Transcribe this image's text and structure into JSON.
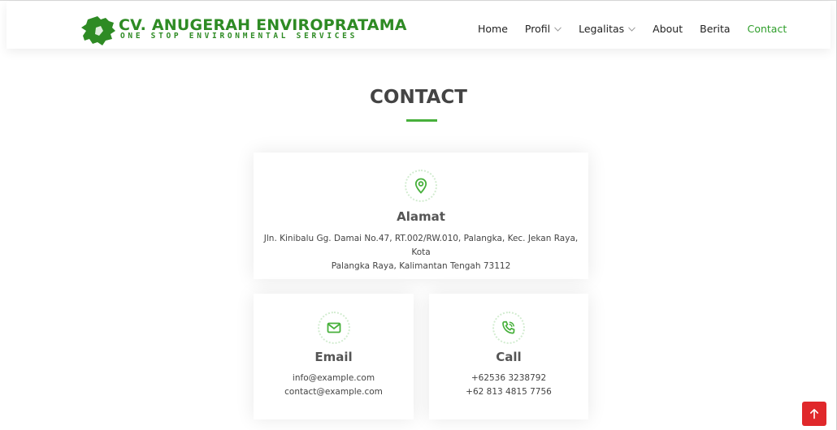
{
  "brand": {
    "name": "CV. ANUGERAH ENVIROPRATAMA",
    "tagline": "ONE STOP ENVIRONMENTAL SERVICES",
    "color": "#2e8b24"
  },
  "nav": {
    "items": [
      {
        "label": "Home",
        "has_dropdown": false,
        "active": false
      },
      {
        "label": "Profil",
        "has_dropdown": true,
        "active": false
      },
      {
        "label": "Legalitas",
        "has_dropdown": true,
        "active": false
      },
      {
        "label": "About",
        "has_dropdown": false,
        "active": false
      },
      {
        "label": "Berita",
        "has_dropdown": false,
        "active": false
      },
      {
        "label": "Contact",
        "has_dropdown": false,
        "active": true
      }
    ],
    "active_color": "#2e9e2a"
  },
  "section": {
    "title": "CONTACT",
    "accent_color": "#47b03b"
  },
  "cards": {
    "address": {
      "icon": "map-pin-icon",
      "heading": "Alamat",
      "line1": "Jln. Kinibalu Gg. Damai No.47, RT.002/RW.010, Palangka, Kec. Jekan Raya, Kota",
      "line2": "Palangka Raya, Kalimantan Tengah 73112"
    },
    "email": {
      "icon": "envelope-icon",
      "heading": "Email",
      "line1": "info@example.com",
      "line2": "contact@example.com"
    },
    "call": {
      "icon": "phone-icon",
      "heading": "Call",
      "line1": "+62536 3238792",
      "line2": "+62 813 4815 7756"
    }
  },
  "back_to_top": {
    "icon": "arrow-up-icon",
    "color": "#e0282b"
  }
}
